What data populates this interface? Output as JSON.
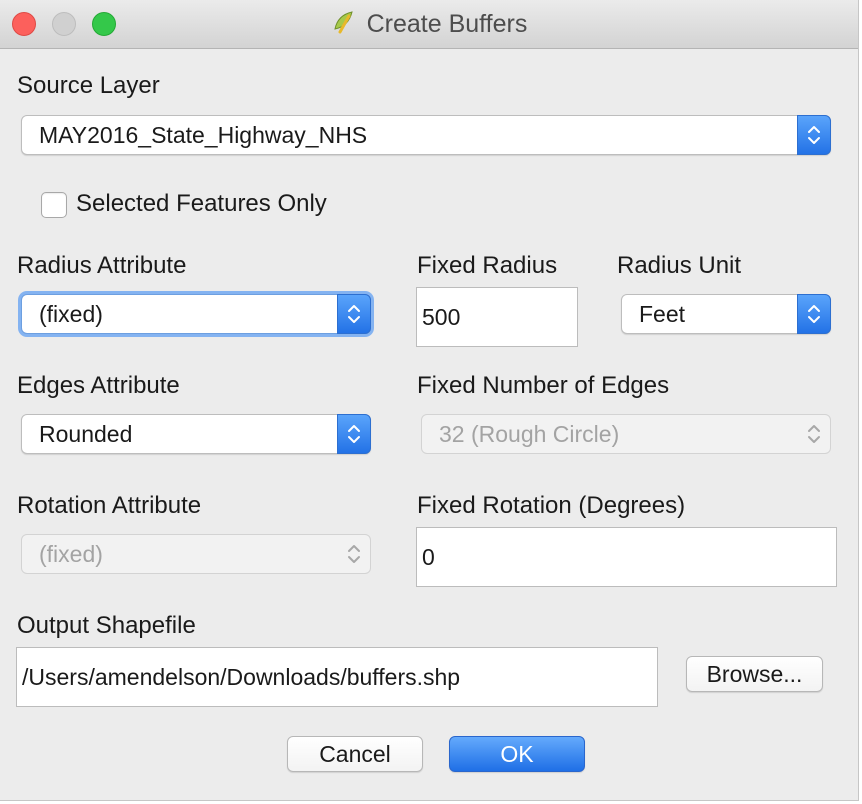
{
  "window": {
    "title": "Create Buffers",
    "app_icon": "qgis-logo-icon"
  },
  "source_layer": {
    "label": "Source Layer",
    "value": "MAY2016_State_Highway_NHS"
  },
  "selected_only": {
    "label": "Selected Features Only",
    "checked": false
  },
  "radius_attribute": {
    "label": "Radius Attribute",
    "value": "(fixed)"
  },
  "fixed_radius": {
    "label": "Fixed Radius",
    "value": "500"
  },
  "radius_unit": {
    "label": "Radius Unit",
    "value": "Feet"
  },
  "edges_attribute": {
    "label": "Edges Attribute",
    "value": "Rounded"
  },
  "fixed_edges": {
    "label": "Fixed Number of Edges",
    "value": "32 (Rough Circle)",
    "enabled": false
  },
  "rotation_attribute": {
    "label": "Rotation Attribute",
    "value": "(fixed)",
    "enabled": false
  },
  "fixed_rotation": {
    "label": "Fixed Rotation (Degrees)",
    "value": "0"
  },
  "output_shapefile": {
    "label": "Output Shapefile",
    "value": "/Users/amendelson/Downloads/buffers.shp"
  },
  "buttons": {
    "browse": "Browse...",
    "cancel": "Cancel",
    "ok": "OK"
  },
  "colors": {
    "accent": "#2372e6",
    "close": "#fc605c",
    "zoom": "#34c84a"
  }
}
